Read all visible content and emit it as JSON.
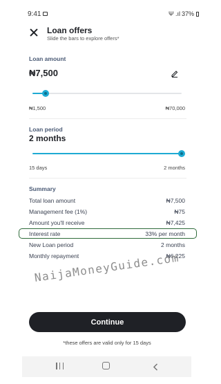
{
  "status_bar": {
    "time": "9:41",
    "signal_text": "Ψ .ıl",
    "battery": "37%"
  },
  "header": {
    "title": "Loan offers",
    "subtitle": "Slide the bars to explore offers*"
  },
  "loan_amount": {
    "label": "Loan amount",
    "value": "₦7,500",
    "min_label": "₦1,500",
    "max_label": "₦70,000",
    "slider_fraction": 0.088
  },
  "loan_period": {
    "label": "Loan period",
    "value": "2 months",
    "min_label": "15 days",
    "max_label": "2 months",
    "slider_fraction": 1.0
  },
  "summary": {
    "label": "Summary",
    "rows": [
      {
        "label": "Total loan amount",
        "value": "₦7,500"
      },
      {
        "label": "Management fee (1%)",
        "value": "₦75"
      },
      {
        "label": "Amount you'll receive",
        "value": "₦7,425"
      },
      {
        "label": "Interest rate",
        "value": "33% per month"
      },
      {
        "label": "New Loan period",
        "value": "2 months"
      },
      {
        "label": "Monthly repayment",
        "value": "₦6,225"
      }
    ]
  },
  "watermark": "NaijaMoneyGuide.com",
  "footer": {
    "continue_label": "Continue",
    "note": "*these offers are valid only for 15 days"
  },
  "colors": {
    "accent": "#1eaad3",
    "button_bg": "#1f2126",
    "highlight": "#2f6b3a"
  }
}
